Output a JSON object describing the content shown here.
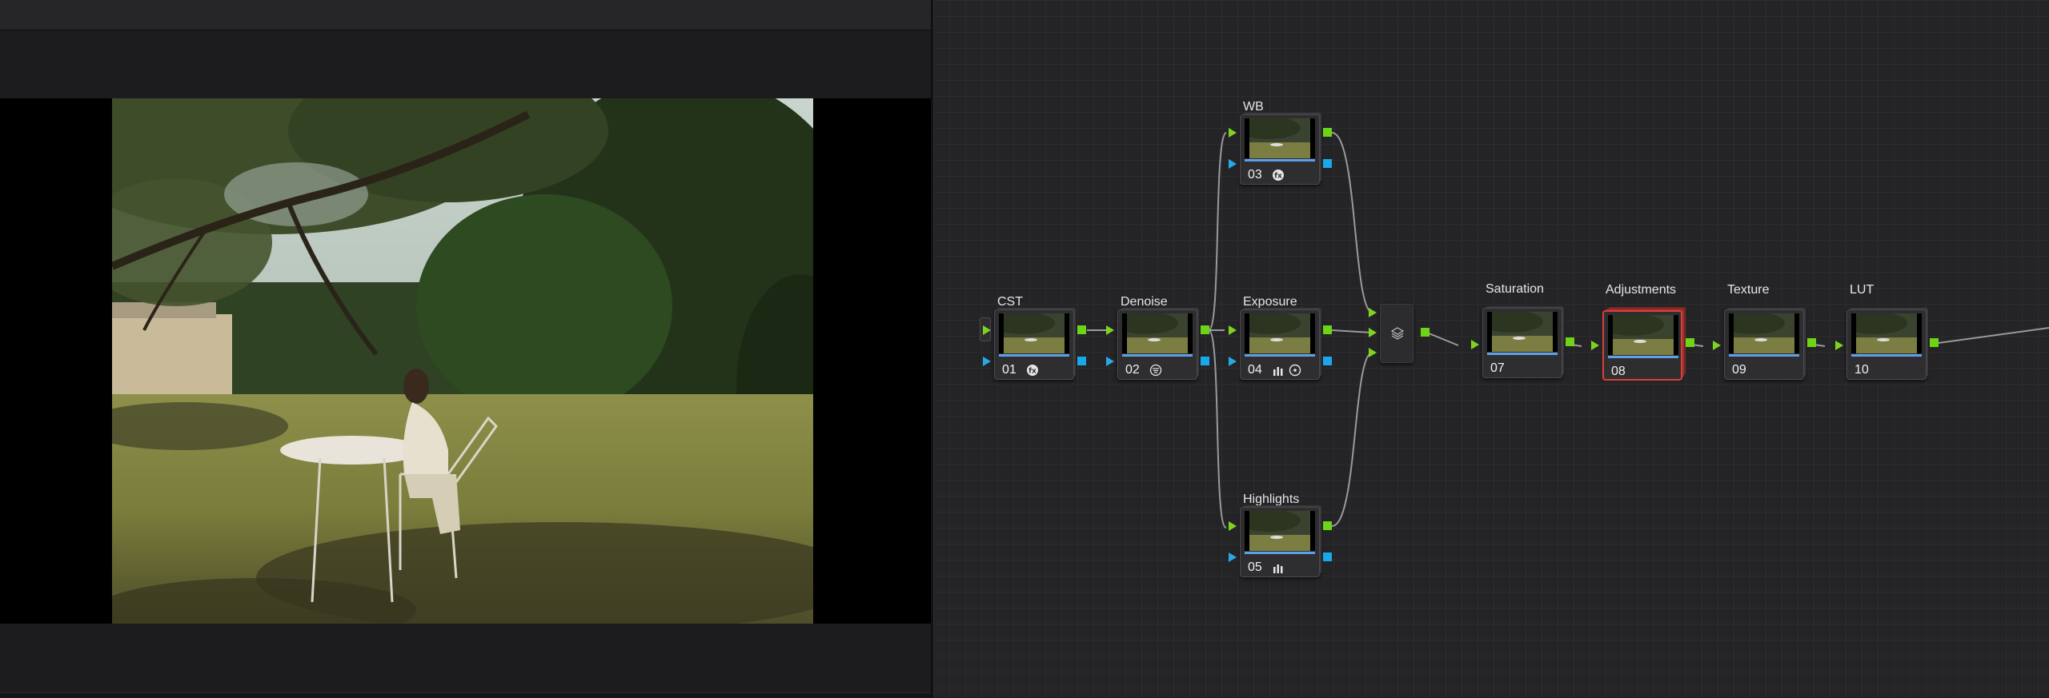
{
  "viewer": {
    "image": "viewer-frame (woman writing at a white table under an oak tree in a sunlit meadow)"
  },
  "node_graph": {
    "nodes": [
      {
        "id": "node-cst",
        "label": "CST",
        "number": "01",
        "icons": [
          "fx-icon"
        ]
      },
      {
        "id": "node-denoise",
        "label": "Denoise",
        "number": "02",
        "icons": [
          "noise-reduction-icon"
        ]
      },
      {
        "id": "node-wb",
        "label": "WB",
        "number": "03",
        "icons": [
          "fx-icon"
        ]
      },
      {
        "id": "node-exposure",
        "label": "Exposure",
        "number": "04",
        "icons": [
          "curves-bars-icon",
          "circle-icon"
        ]
      },
      {
        "id": "node-highlights",
        "label": "Highlights",
        "number": "05",
        "icons": [
          "curves-bars-icon"
        ]
      },
      {
        "id": "node-saturation",
        "label": "Saturation",
        "number": "07",
        "icons": []
      },
      {
        "id": "node-adjustments",
        "label": "Adjustments",
        "number": "08",
        "icons": [],
        "selected": true
      },
      {
        "id": "node-texture",
        "label": "Texture",
        "number": "09",
        "icons": []
      },
      {
        "id": "node-lut",
        "label": "LUT",
        "number": "10",
        "icons": []
      }
    ],
    "layer_mixer_icon": "layers-icon",
    "colors": {
      "rgb_port": "#7ed321",
      "alpha_port": "#27a9e8",
      "selected_border": "#d6403a",
      "thumb_bar": "#5fa0e8"
    }
  }
}
